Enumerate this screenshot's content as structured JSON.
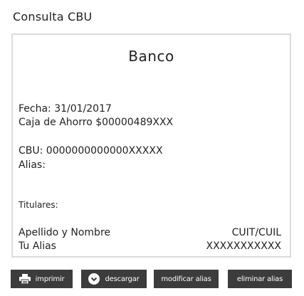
{
  "title": "Consulta CBU",
  "card": {
    "bank": "Banco",
    "fecha": "Fecha: 31/01/2017",
    "cuenta": "Caja de Ahorro $00000489XXX",
    "cbu": "CBU: 0000000000000XXXXX",
    "alias": "Alias:",
    "titulares_label": "Titulares:",
    "col_nombre": "Apellido y Nombre",
    "col_cuit": "CUIT/CUIL",
    "row_alias": "Tu Alias",
    "row_cuit": "XXXXXXXXXXX"
  },
  "actions": {
    "print": "imprimir",
    "download": "descargar",
    "modify": "modificar alias",
    "delete": "eliminar alias"
  },
  "icons": {
    "print": "printer-icon",
    "download": "download-circle-icon"
  },
  "colors": {
    "button_bg": "#3c3c3c",
    "card_border": "#dcdcdc"
  }
}
